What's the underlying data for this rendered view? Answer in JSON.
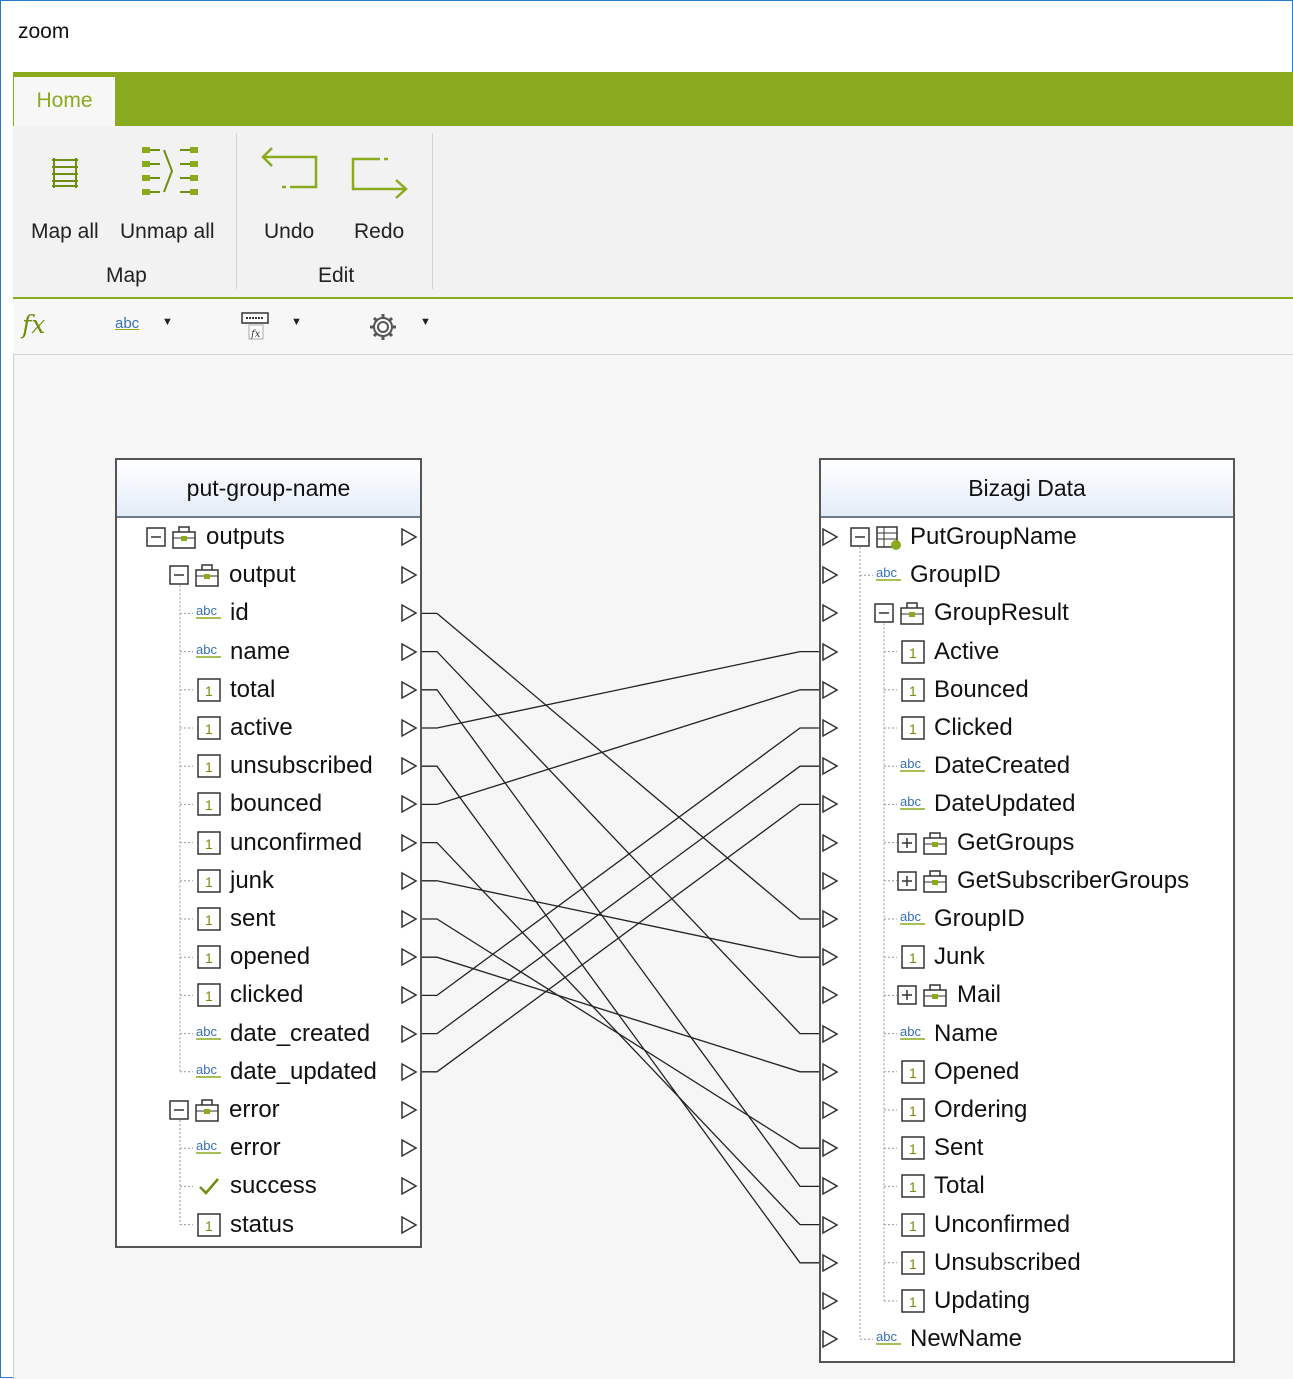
{
  "window": {
    "title": "zoom"
  },
  "ribbon": {
    "tabs": [
      {
        "label": "Home"
      }
    ],
    "accent_color": "#8aab1e",
    "groups": [
      {
        "label": "Map",
        "buttons": [
          {
            "label": "Map all",
            "icon": "map-all-icon"
          },
          {
            "label": "Unmap all",
            "icon": "unmap-all-icon"
          }
        ]
      },
      {
        "label": "Edit",
        "buttons": [
          {
            "label": "Undo",
            "icon": "undo-icon"
          },
          {
            "label": "Redo",
            "icon": "redo-icon"
          }
        ]
      }
    ]
  },
  "toolbar": {
    "buttons": [
      {
        "icon": "function-icon",
        "label": "fx"
      },
      {
        "icon": "string-function-icon",
        "label": "abc"
      },
      {
        "icon": "formula-icon"
      },
      {
        "icon": "settings-gear-icon"
      }
    ]
  },
  "source": {
    "title": "put-group-name",
    "nodes": [
      {
        "label": "outputs",
        "type": "object",
        "expander": "-"
      },
      {
        "label": "output",
        "type": "object",
        "expander": "-"
      },
      {
        "label": "id",
        "type": "string"
      },
      {
        "label": "name",
        "type": "string"
      },
      {
        "label": "total",
        "type": "number"
      },
      {
        "label": "active",
        "type": "number"
      },
      {
        "label": "unsubscribed",
        "type": "number"
      },
      {
        "label": "bounced",
        "type": "number"
      },
      {
        "label": "unconfirmed",
        "type": "number"
      },
      {
        "label": "junk",
        "type": "number"
      },
      {
        "label": "sent",
        "type": "number"
      },
      {
        "label": "opened",
        "type": "number"
      },
      {
        "label": "clicked",
        "type": "number"
      },
      {
        "label": "date_created",
        "type": "string"
      },
      {
        "label": "date_updated",
        "type": "string"
      },
      {
        "label": "error",
        "type": "object",
        "expander": "-"
      },
      {
        "label": "error",
        "type": "string"
      },
      {
        "label": "success",
        "type": "boolean"
      },
      {
        "label": "status",
        "type": "number"
      }
    ]
  },
  "target": {
    "title": "Bizagi Data",
    "nodes": [
      {
        "label": "PutGroupName",
        "type": "entity",
        "expander": "-"
      },
      {
        "label": "GroupID",
        "type": "string"
      },
      {
        "label": "GroupResult",
        "type": "object",
        "expander": "-"
      },
      {
        "label": "Active",
        "type": "number"
      },
      {
        "label": "Bounced",
        "type": "number"
      },
      {
        "label": "Clicked",
        "type": "number"
      },
      {
        "label": "DateCreated",
        "type": "string"
      },
      {
        "label": "DateUpdated",
        "type": "string"
      },
      {
        "label": "GetGroups",
        "type": "object",
        "expander": "+"
      },
      {
        "label": "GetSubscriberGroups",
        "type": "object",
        "expander": "+"
      },
      {
        "label": "GroupID",
        "type": "string"
      },
      {
        "label": "Junk",
        "type": "number"
      },
      {
        "label": "Mail",
        "type": "object",
        "expander": "+"
      },
      {
        "label": "Name",
        "type": "string"
      },
      {
        "label": "Opened",
        "type": "number"
      },
      {
        "label": "Ordering",
        "type": "number"
      },
      {
        "label": "Sent",
        "type": "number"
      },
      {
        "label": "Total",
        "type": "number"
      },
      {
        "label": "Unconfirmed",
        "type": "number"
      },
      {
        "label": "Unsubscribed",
        "type": "number"
      },
      {
        "label": "Updating",
        "type": "number"
      },
      {
        "label": "NewName",
        "type": "string"
      }
    ]
  },
  "mappings": [
    {
      "from": "id",
      "to": "GroupID"
    },
    {
      "from": "name",
      "to": "Name"
    },
    {
      "from": "total",
      "to": "Total"
    },
    {
      "from": "active",
      "to": "Active"
    },
    {
      "from": "unsubscribed",
      "to": "Unsubscribed"
    },
    {
      "from": "bounced",
      "to": "Bounced"
    },
    {
      "from": "unconfirmed",
      "to": "Unconfirmed"
    },
    {
      "from": "junk",
      "to": "Junk"
    },
    {
      "from": "sent",
      "to": "Sent"
    },
    {
      "from": "opened",
      "to": "Opened"
    },
    {
      "from": "clicked",
      "to": "Clicked"
    },
    {
      "from": "date_created",
      "to": "DateCreated"
    },
    {
      "from": "date_updated",
      "to": "DateUpdated"
    }
  ]
}
